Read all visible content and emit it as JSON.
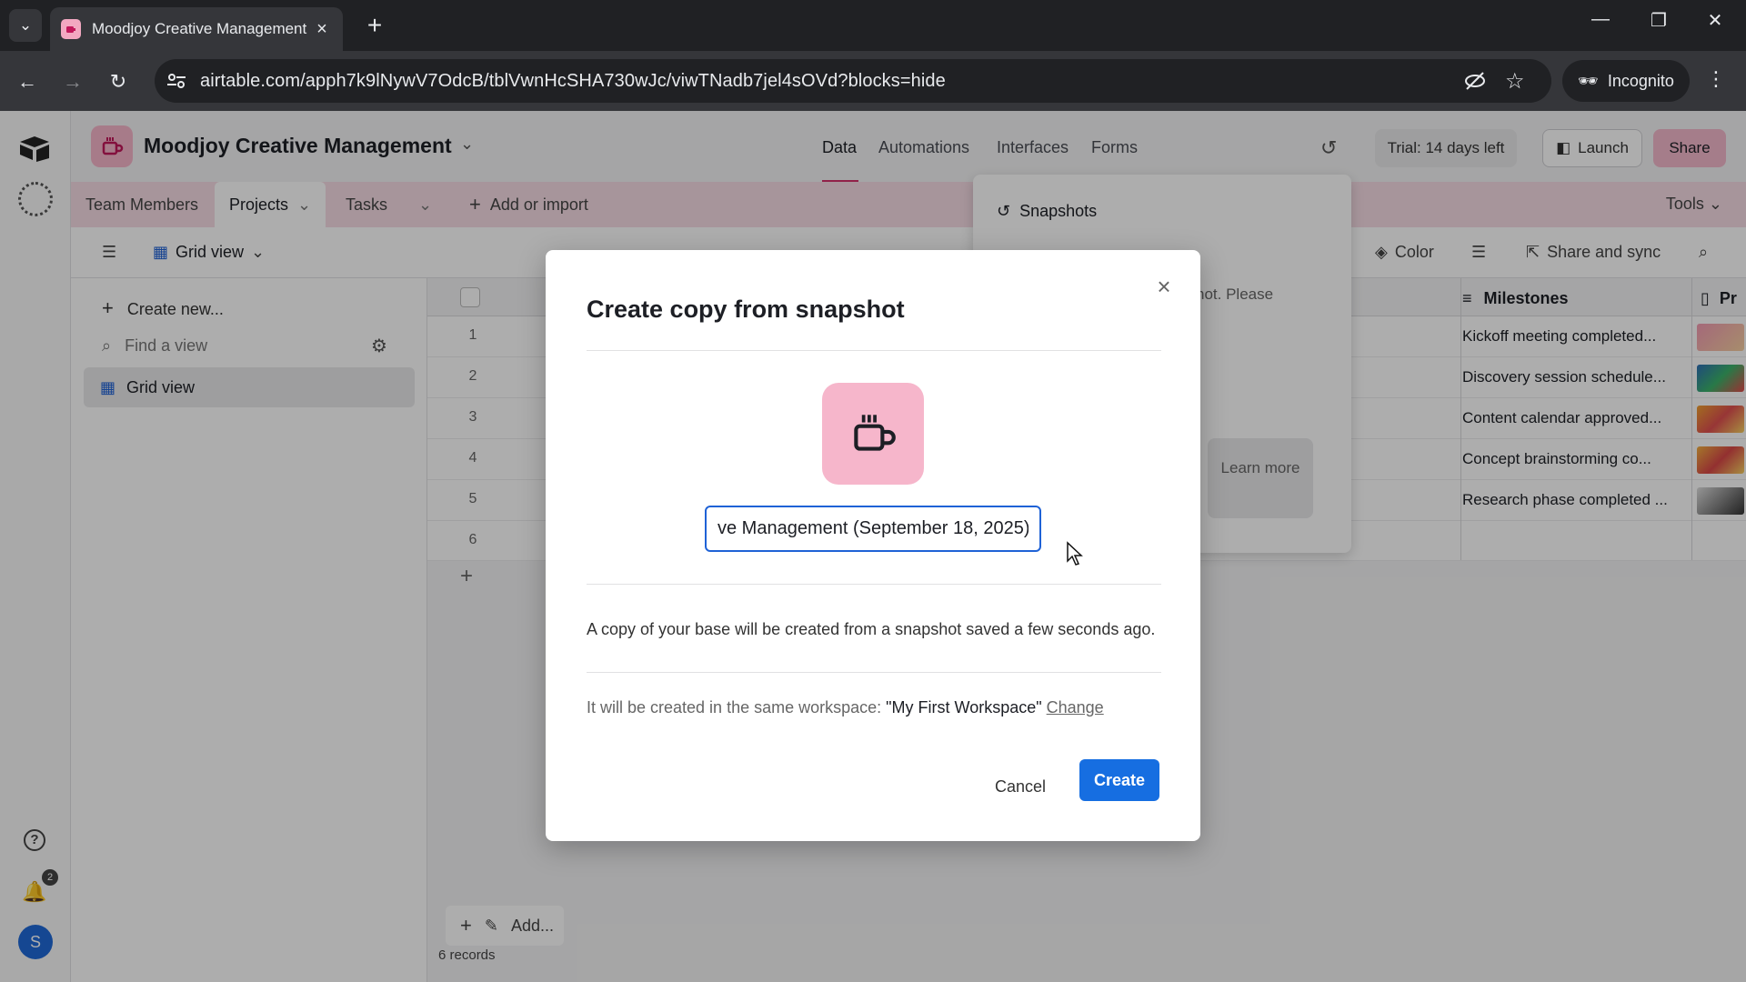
{
  "browser": {
    "tab_title": "Moodjoy Creative Management",
    "url": "airtable.com/apph7k9lNywV7OdcB/tblVwnHcSHA730wJc/viwTNadb7jel4sOVd?blocks=hide",
    "incognito_label": "Incognito"
  },
  "base": {
    "name": "Moodjoy Creative Management",
    "nav": [
      "Data",
      "Automations",
      "Interfaces",
      "Forms"
    ],
    "trial": "Trial: 14 days left",
    "launch": "Launch",
    "share": "Share"
  },
  "tables": {
    "tabs": [
      "Team Members",
      "Projects",
      "Tasks"
    ],
    "add_or_import": "Add or import",
    "tools": "Tools"
  },
  "viewbar": {
    "view_name": "Grid view",
    "color": "Color",
    "share_sync": "Share and sync"
  },
  "sidebar": {
    "create_new": "Create new...",
    "find_placeholder": "Find a view",
    "grid_view": "Grid view"
  },
  "grid": {
    "milestones_header": "Milestones",
    "pr_header": "Pr",
    "row_numbers": [
      "1",
      "2",
      "3",
      "4",
      "5",
      "6"
    ],
    "milestones": [
      "Kickoff meeting completed...",
      "Discovery session schedule...",
      "Content calendar approved...",
      "Concept brainstorming co...",
      "Research phase completed ..."
    ],
    "footer_add": "Add...",
    "records": "6 records"
  },
  "snapshots": {
    "title": "Snapshots",
    "partial_text": "hot. Please",
    "learn_more": "Learn more"
  },
  "modal": {
    "title": "Create copy from snapshot",
    "name_value": "ve Management (September 18, 2025)",
    "description": "A copy of your base will be created from a snapshot saved a few seconds ago.",
    "workspace_prefix": "It will be created in the same workspace: ",
    "workspace_name": "\"My First Workspace\"",
    "change": "Change",
    "cancel": "Cancel",
    "create": "Create"
  },
  "notifications": {
    "count": "2"
  },
  "user": {
    "initial": "S"
  },
  "colors": {
    "accent_pink": "#f6b6cb",
    "primary_blue": "#166ee1"
  }
}
